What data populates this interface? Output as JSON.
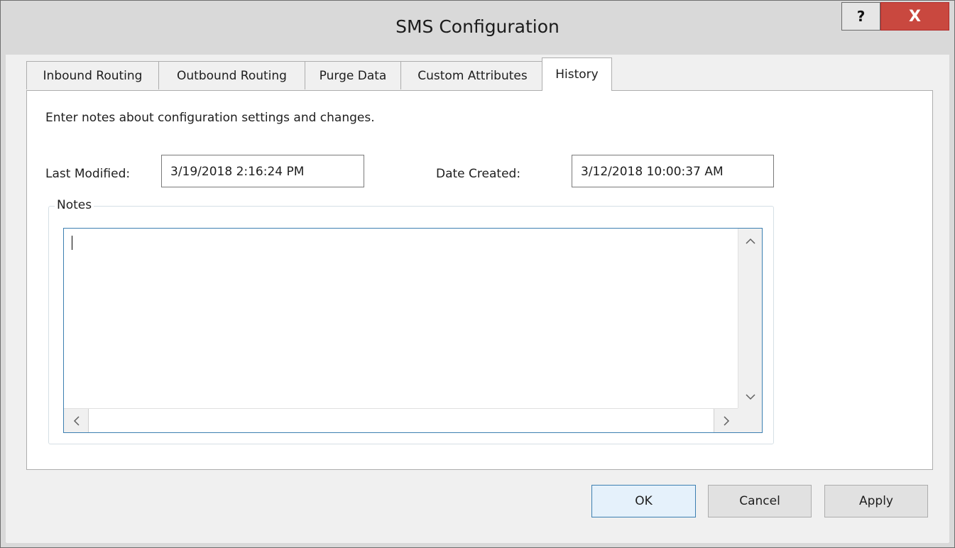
{
  "window": {
    "title": "SMS Configuration",
    "help_label": "?",
    "close_label": "X"
  },
  "tabs": [
    {
      "label": "Inbound Routing",
      "active": false
    },
    {
      "label": "Outbound Routing",
      "active": false
    },
    {
      "label": "Purge Data",
      "active": false
    },
    {
      "label": "Custom Attributes",
      "active": false
    },
    {
      "label": "History",
      "active": true
    }
  ],
  "history": {
    "description": "Enter notes about configuration settings and changes.",
    "last_modified_label": "Last Modified:",
    "last_modified_value": "3/19/2018 2:16:24 PM",
    "date_created_label": "Date Created:",
    "date_created_value": "3/12/2018 10:00:37 AM",
    "notes_group_label": "Notes",
    "notes_value": ""
  },
  "buttons": {
    "ok": "OK",
    "cancel": "Cancel",
    "apply": "Apply"
  },
  "colors": {
    "close_button": "#c9483f",
    "focus_border": "#3c7fb1",
    "titlebar": "#d9d9d9"
  }
}
